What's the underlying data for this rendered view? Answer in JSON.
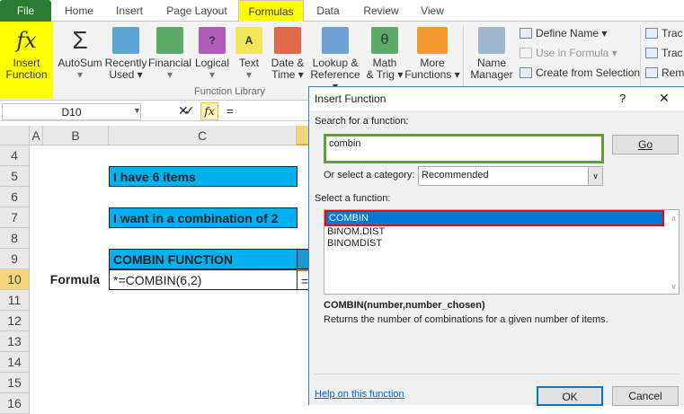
{
  "ribbon_tabs": [
    "File",
    "Home",
    "Insert",
    "Page Layout",
    "Formulas",
    "Data",
    "Review",
    "View"
  ],
  "ribbon": {
    "insert_function": [
      "Insert",
      "Function"
    ],
    "autosum": [
      "AutoSum",
      "▾"
    ],
    "recently_used": [
      "Recently",
      "Used ▾"
    ],
    "financial": [
      "Financial",
      "▾"
    ],
    "logical": [
      "Logical",
      "▾"
    ],
    "text": [
      "Text",
      "▾"
    ],
    "date_time": [
      "Date &",
      "Time ▾"
    ],
    "lookup": [
      "Lookup &",
      "Reference ▾"
    ],
    "math": [
      "Math",
      "& Trig ▾"
    ],
    "more": [
      "More",
      "Functions ▾"
    ],
    "group_label": "Function Library",
    "name_manager": [
      "Name",
      "Manager"
    ],
    "define_name": "Define Name ▾",
    "use_in_formula": "Use in Formula ▾",
    "create_from_selection": "Create from Selection",
    "trace1": "Trac",
    "trace2": "Trac",
    "remove": "Rem"
  },
  "formula_bar": {
    "name_box": "D10",
    "fx": "fx",
    "content": "="
  },
  "sheet": {
    "columns": [
      "A",
      "B",
      "C"
    ],
    "rows": [
      "4",
      "5",
      "6",
      "7",
      "8",
      "9",
      "10",
      "11",
      "12",
      "13",
      "14",
      "15",
      "16"
    ],
    "c5": "I have 6 items",
    "c7": "I want in a combination of 2",
    "c9": "COMBIN FUNCTION",
    "b10": "Formula",
    "c10": "*=COMBIN(6,2)",
    "d10": "="
  },
  "dialog": {
    "title": "Insert Function",
    "help": "?",
    "close": "✕",
    "search_label": "Search for a function:",
    "search_value": "combin",
    "go": "Go",
    "category_label": "Or select a category:",
    "category_value": "Recommended",
    "select_label": "Select a function:",
    "functions": [
      "COMBIN",
      "BINOM.DIST",
      "BINOMDIST"
    ],
    "signature": "COMBIN(number,number_chosen)",
    "description": "Returns the number of combinations for a given number of items.",
    "help_link": "Help on this function",
    "ok": "OK",
    "cancel": "Cancel"
  }
}
